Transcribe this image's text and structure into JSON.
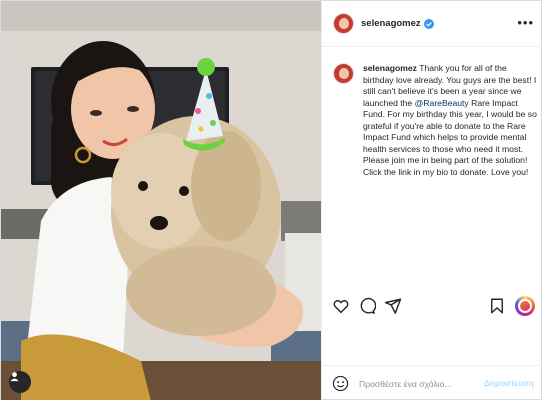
{
  "header": {
    "username": "selenagomez",
    "more_icon": "more-horizontal-icon"
  },
  "caption": {
    "username": "selenagomez",
    "text_before_mention": "Thank you for all of the birthday love already. You guys are the best! I still can't believe it's been a year since we launched the ",
    "mention": "@RareBeauty",
    "text_after_mention": " Rare Impact Fund. For my birthday this year, I would be so grateful if you're able to donate to the Rare Impact Fund which helps to provide mental health services to those who need it most. Please join me in being part of the solution! Click the link in my bio to donate. Love you!"
  },
  "actions": {
    "icons": [
      "heart-icon",
      "comment-icon",
      "send-icon",
      "bookmark-icon",
      "story-ring-icon"
    ]
  },
  "comment_bar": {
    "placeholder": "Προσθέστε ένα σχόλιο...",
    "post_label": "Δημοσίευση"
  },
  "colors": {
    "verified_blue": "#3897f0",
    "link_blue": "#00376b",
    "post_button_disabled": "#b2dffc",
    "border": "#dbdbdb"
  }
}
